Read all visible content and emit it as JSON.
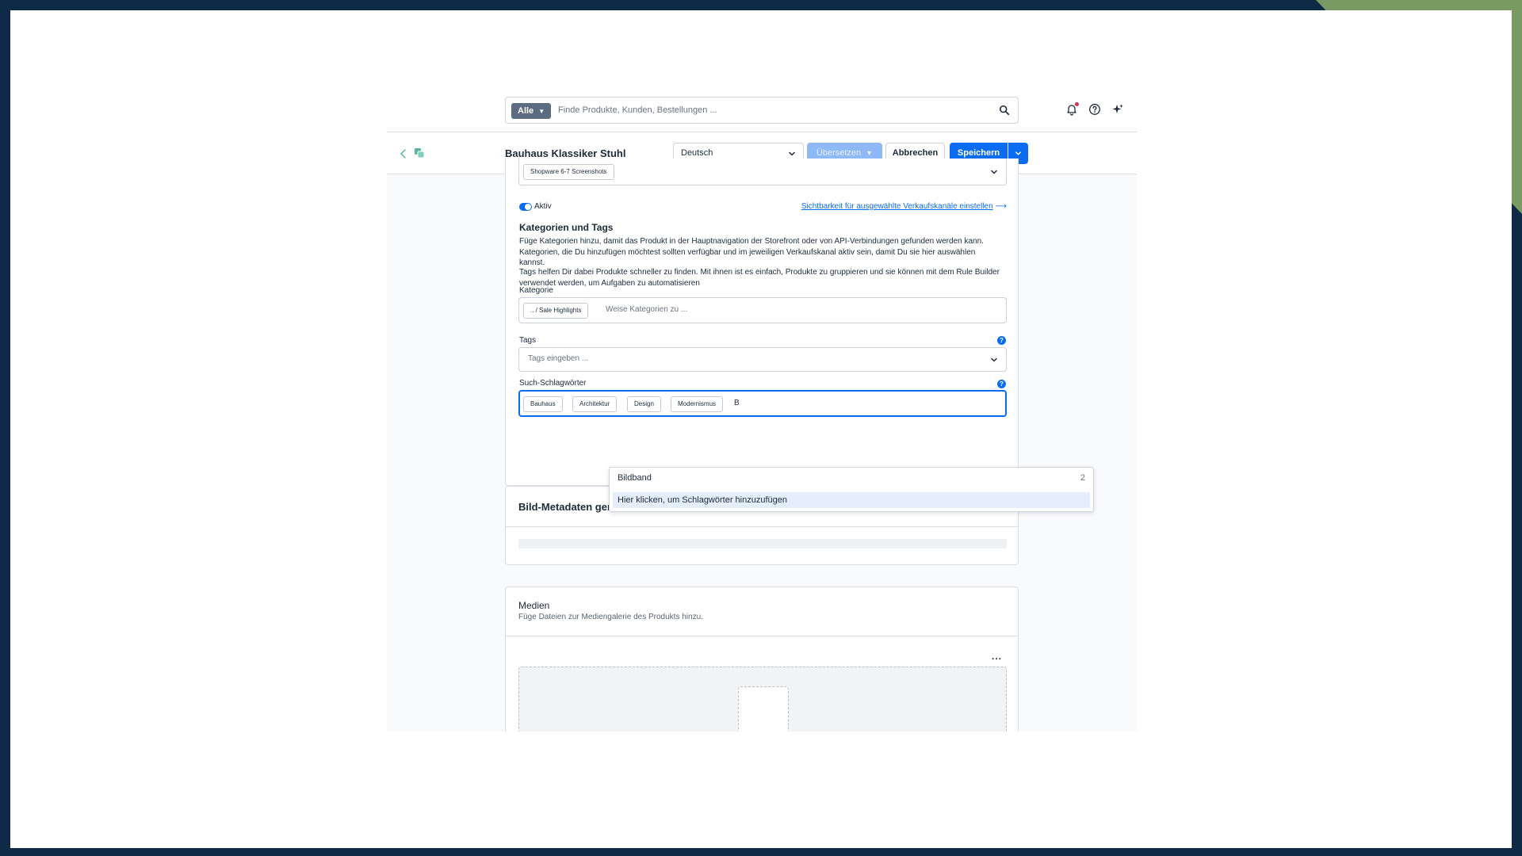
{
  "colors": {
    "primary": "#0a6cf0",
    "background": "#0e2a47",
    "accent_stripe": "#7a9a63",
    "notification_dot": "#de294c"
  },
  "search": {
    "type_label": "Alle",
    "placeholder": "Finde Produkte, Kunden, Bestellungen ..."
  },
  "header": {
    "icons": [
      "bell-icon",
      "help-icon",
      "sparkle-icon"
    ]
  },
  "smartbar": {
    "title": "Bauhaus Klassiker Stuhl",
    "language": "Deutsch",
    "translate_label": "Übersetzen",
    "cancel_label": "Abbrechen",
    "save_label": "Speichern"
  },
  "visibility": {
    "sales_channel_chip": "Shopware 6-7 Screenshots",
    "active_label": "Aktiv",
    "active": true,
    "link_label": "Sichtbarkeit für ausgewählte Verkaufskanäle einstellen"
  },
  "categories_section": {
    "title": "Kategorien und Tags",
    "description_1": "Füge Kategorien hinzu, damit das Produkt in der Hauptnavigation der Storefront oder von API-Verbindungen gefunden werden kann. Kategorien, die Du hinzufügen möchtest sollten verfügbar und im jeweiligen Verkaufskanal aktiv sein, damit Du sie hier auswählen kannst.",
    "description_2": "Tags helfen Dir dabei Produkte schneller zu finden. Mit ihnen ist es einfach, Produkte zu gruppieren und sie können mit dem Rule Builder verwendet werden, um Aufgaben zu automatisieren",
    "category_label": "Kategorie",
    "category_chip": ".. / Sale Highlights",
    "category_placeholder": "Weise Kategorien zu ...",
    "tags_label": "Tags",
    "tags_placeholder": "Tags eingeben ...",
    "keywords_label": "Such-Schlagwörter",
    "keywords": [
      "Bauhaus",
      "Architektur",
      "Design",
      "Modernismus"
    ],
    "keyword_input": "B"
  },
  "keyword_dropdown": {
    "suggestion": "Bildband",
    "suggestion_count": "2",
    "add_hint": "Hier klicken, um Schlagwörter hinzuzufügen"
  },
  "metadata_card": {
    "title": "Bild-Metadaten generieren"
  },
  "media_card": {
    "title": "Medien",
    "subtitle": "Füge Dateien zur Mediengalerie des Produkts hinzu.",
    "more_label": "..."
  }
}
